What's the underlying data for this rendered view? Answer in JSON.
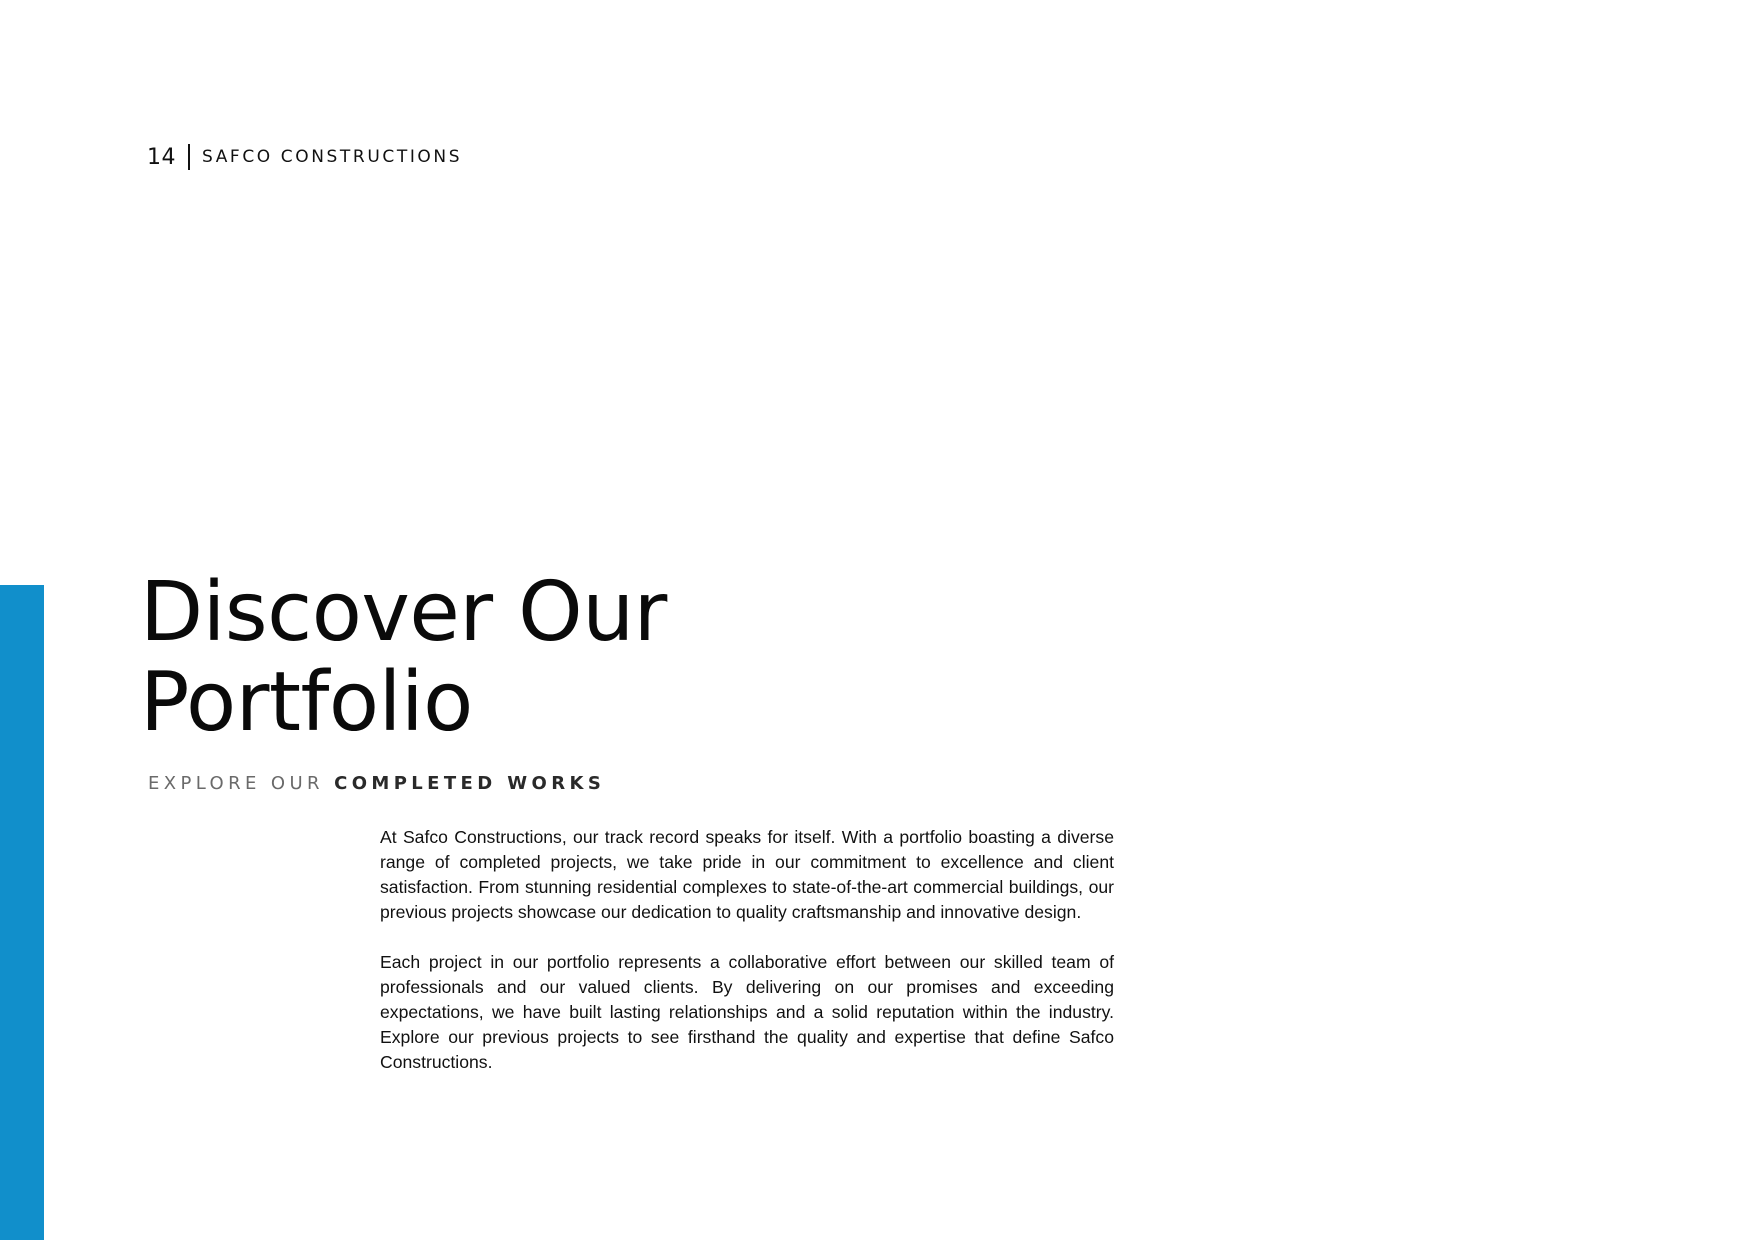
{
  "header": {
    "page_number": "14",
    "brand": "SAFCO CONSTRUCTIONS"
  },
  "title": {
    "line1": "Discover Our",
    "line2": "Portfolio"
  },
  "subtitle": {
    "light": "EXPLORE OUR",
    "bold": "COMPLETED WORKS"
  },
  "body": {
    "paragraph1": "At Safco Constructions, our track record speaks for itself. With a portfolio boasting a diverse range of completed projects, we take pride in our commitment to excellence and client satisfaction. From stunning residential complexes to state-of-the-art commercial buildings, our previous projects showcase our dedication to quality craftsmanship and innovative design.",
    "paragraph2": "Each project in our portfolio represents a collaborative effort between our skilled team of professionals and our valued clients. By delivering on our promises and exceeding expectations, we have built lasting relationships and a solid reputation within the industry. Explore our previous projects to see firsthand the quality and expertise that define Safco Constructions."
  },
  "colors": {
    "accent": "#118fcb",
    "text": "#111111",
    "subtitle_light": "#6a6a6a"
  }
}
